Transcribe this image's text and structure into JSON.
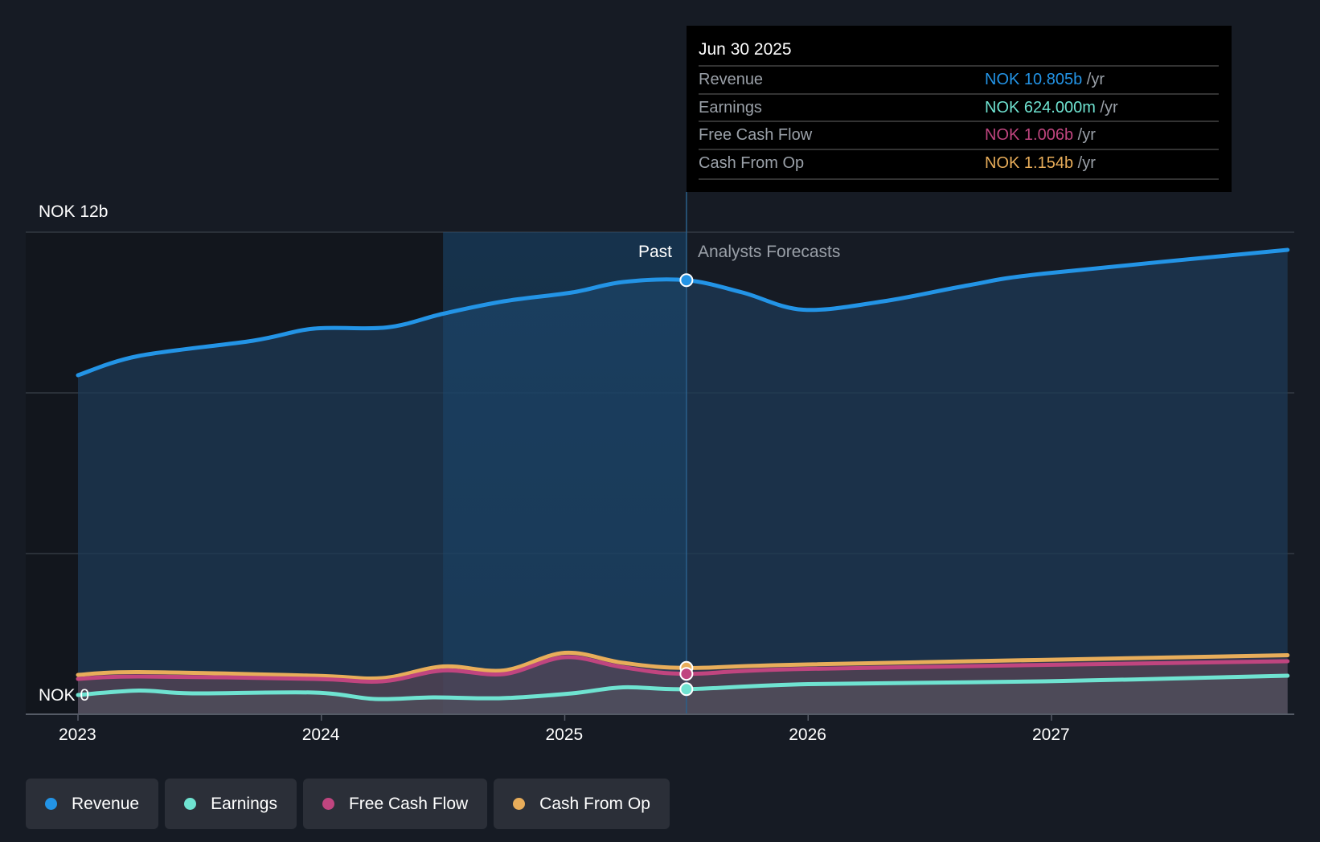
{
  "tooltip": {
    "date": "Jun 30 2025",
    "rows": [
      {
        "label": "Revenue",
        "value": "NOK 10.805b",
        "unit": "/yr",
        "color": "#2394e6"
      },
      {
        "label": "Earnings",
        "value": "NOK 624.000m",
        "unit": "/yr",
        "color": "#6fe3d1"
      },
      {
        "label": "Free Cash Flow",
        "value": "NOK 1.006b",
        "unit": "/yr",
        "color": "#c0457f"
      },
      {
        "label": "Cash From Op",
        "value": "NOK 1.154b",
        "unit": "/yr",
        "color": "#e8ad5a"
      }
    ]
  },
  "legend": [
    {
      "label": "Revenue",
      "color": "#2394e6"
    },
    {
      "label": "Earnings",
      "color": "#6fe3d1"
    },
    {
      "label": "Free Cash Flow",
      "color": "#c0457f"
    },
    {
      "label": "Cash From Op",
      "color": "#e8ad5a"
    }
  ],
  "chart_data": {
    "type": "line",
    "ylabel_top": "NOK 12b",
    "ylabel_bottom": "NOK 0",
    "ylim": [
      0,
      12
    ],
    "xlim": [
      2022.98,
      2027.97
    ],
    "x_ticks": [
      "2023",
      "2024",
      "2025",
      "2026",
      "2027"
    ],
    "past_label": "Past",
    "forecast_label": "Analysts Forecasts",
    "divider_x": 2025.5,
    "highlight_start_x": 2024.5,
    "series": [
      {
        "name": "Revenue",
        "color": "#2394e6",
        "points": [
          [
            2023.0,
            8.44
          ],
          [
            2023.25,
            8.92
          ],
          [
            2023.72,
            9.3
          ],
          [
            2023.97,
            9.6
          ],
          [
            2024.27,
            9.63
          ],
          [
            2024.5,
            9.97
          ],
          [
            2024.75,
            10.28
          ],
          [
            2025.03,
            10.5
          ],
          [
            2025.24,
            10.76
          ],
          [
            2025.5,
            10.805
          ],
          [
            2025.73,
            10.5
          ],
          [
            2025.98,
            10.07
          ],
          [
            2026.31,
            10.28
          ],
          [
            2026.66,
            10.68
          ],
          [
            2026.97,
            10.97
          ],
          [
            2027.97,
            11.56
          ]
        ]
      },
      {
        "name": "Cash From Op",
        "color": "#e8ad5a",
        "points": [
          [
            2023.0,
            0.98
          ],
          [
            2023.25,
            1.05
          ],
          [
            2023.97,
            0.96
          ],
          [
            2024.25,
            0.9
          ],
          [
            2024.5,
            1.19
          ],
          [
            2024.75,
            1.09
          ],
          [
            2025.0,
            1.53
          ],
          [
            2025.24,
            1.28
          ],
          [
            2025.5,
            1.154
          ],
          [
            2026.0,
            1.24
          ],
          [
            2027.97,
            1.47
          ]
        ]
      },
      {
        "name": "Free Cash Flow",
        "color": "#c0457f",
        "points": [
          [
            2023.0,
            0.88
          ],
          [
            2023.25,
            0.94
          ],
          [
            2023.97,
            0.88
          ],
          [
            2024.25,
            0.82
          ],
          [
            2024.5,
            1.09
          ],
          [
            2024.75,
            1.0
          ],
          [
            2025.0,
            1.42
          ],
          [
            2025.24,
            1.17
          ],
          [
            2025.5,
            1.006
          ],
          [
            2026.0,
            1.13
          ],
          [
            2027.97,
            1.32
          ]
        ]
      },
      {
        "name": "Earnings",
        "color": "#6fe3d1",
        "points": [
          [
            2023.0,
            0.48
          ],
          [
            2023.25,
            0.59
          ],
          [
            2023.47,
            0.52
          ],
          [
            2023.97,
            0.54
          ],
          [
            2024.22,
            0.38
          ],
          [
            2024.46,
            0.42
          ],
          [
            2024.74,
            0.4
          ],
          [
            2025.03,
            0.52
          ],
          [
            2025.24,
            0.67
          ],
          [
            2025.5,
            0.624
          ],
          [
            2026.0,
            0.75
          ],
          [
            2026.97,
            0.82
          ],
          [
            2027.97,
            0.96
          ]
        ]
      }
    ]
  }
}
